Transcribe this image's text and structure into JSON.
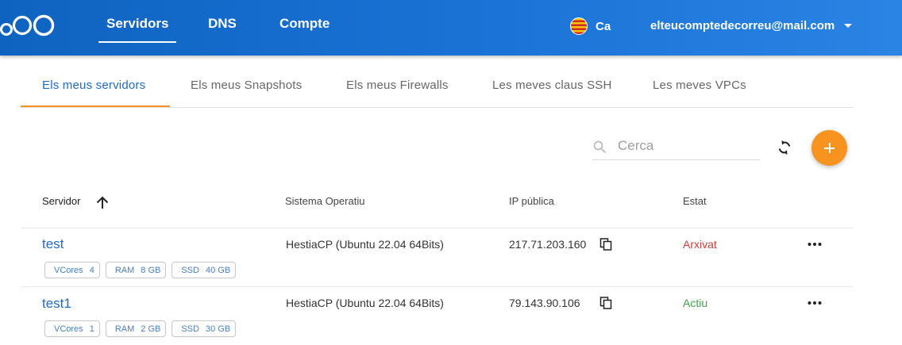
{
  "topnav": {
    "items": [
      {
        "label": "Servidors",
        "active": true
      },
      {
        "label": "DNS",
        "active": false
      },
      {
        "label": "Compte",
        "active": false
      }
    ],
    "language": "Ca",
    "account_email": "elteucomptedecorreu@mail.com"
  },
  "subtabs": [
    {
      "label": "Els meus servidors",
      "active": true
    },
    {
      "label": "Els meus Snapshots",
      "active": false
    },
    {
      "label": "Els meus Firewalls",
      "active": false
    },
    {
      "label": "Les meves claus SSH",
      "active": false
    },
    {
      "label": "Les meves VPCs",
      "active": false
    }
  ],
  "search": {
    "placeholder": "Cerca",
    "value": ""
  },
  "table": {
    "columns": [
      "Servidor",
      "Sistema Operatiu",
      "IP pública",
      "Estat"
    ],
    "sort_column": "Servidor",
    "sort_direction": "ascending",
    "rows": [
      {
        "name": "test",
        "specs": [
          {
            "label": "VCores",
            "value": "4"
          },
          {
            "label": "RAM",
            "value": "8 GB"
          },
          {
            "label": "SSD",
            "value": "40 GB"
          }
        ],
        "os": "HestiaCP (Ubuntu 22.04 64Bits)",
        "ip": "217.71.203.160",
        "status": "Arxivat"
      },
      {
        "name": "test1",
        "specs": [
          {
            "label": "VCores",
            "value": "1"
          },
          {
            "label": "RAM",
            "value": "2 GB"
          },
          {
            "label": "SSD",
            "value": "30 GB"
          }
        ],
        "os": "HestiaCP (Ubuntu 22.04 64Bits)",
        "ip": "79.143.90.106",
        "status": "Actiu"
      }
    ]
  },
  "colors": {
    "header": "#1a73d6",
    "accent": "#f7931e",
    "link": "#1f6bc6",
    "status_archived": "#d0413a",
    "status_active": "#3ea34a"
  },
  "icons": [
    "logo",
    "flag-catalonia-icon",
    "chevron-down-icon",
    "search-icon",
    "refresh-icon",
    "add-icon",
    "sort-arrow-up-icon",
    "copy-icon",
    "more-horizontal-icon"
  ]
}
